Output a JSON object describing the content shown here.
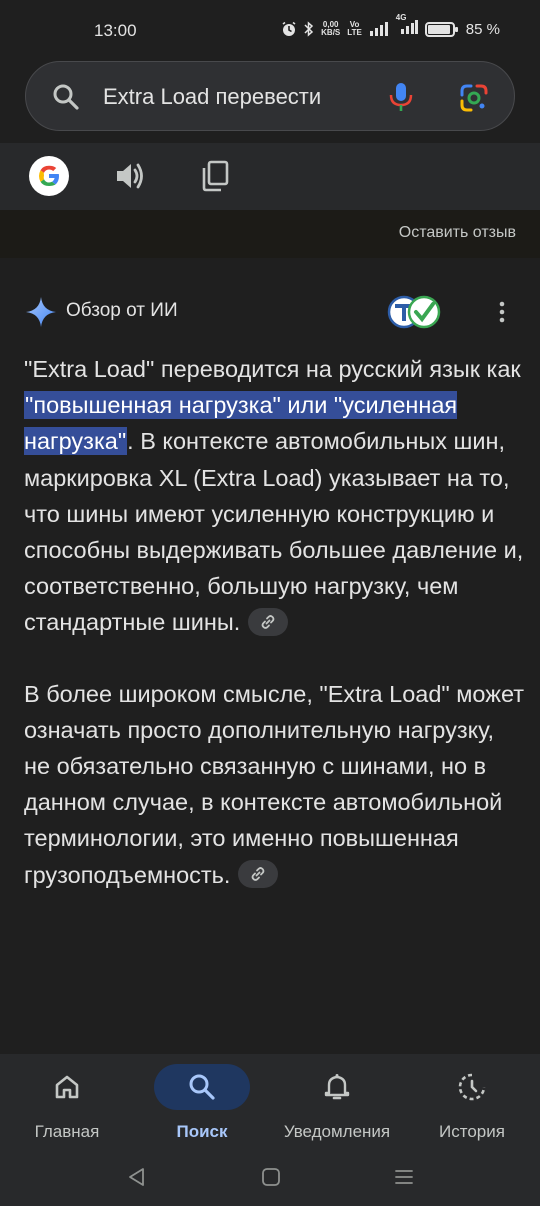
{
  "status": {
    "time": "13:00",
    "net_speed_top": "0,00",
    "net_speed_bottom": "KB/S",
    "volte_top": "Vo",
    "volte_bottom": "LTE",
    "lte_label": "4G",
    "battery": "85 %"
  },
  "search": {
    "query": "Extra Load перевести"
  },
  "tools": {
    "icons": [
      "google-logo",
      "speaker-icon",
      "copy-icon"
    ]
  },
  "feedback": {
    "label": "Оставить отзыв"
  },
  "ai_overview": {
    "title": "Обзор от ИИ",
    "p1_before": "\"Extra Load\" переводится на русский язык как ",
    "p1_highlight": "\"повышенная нагрузка\" или \"усиленная нагрузка\"",
    "p1_after": ". В контексте автомобильных шин, маркировка XL (Extra Load) указывает на то, что шины имеют усиленную конструкцию и способны выдерживать большее давление и, соответственно, большую нагрузку, чем стандартные шины.",
    "p2": "В более широком смысле, \"Extra Load\" может означать просто дополнительную нагрузку, не обязательно связанную с шинами, но в данном случае, в контексте автомобильной терминологии, это именно повышенная грузоподъемность."
  },
  "bottom_nav": {
    "items": [
      {
        "label": "Главная",
        "icon": "home-icon",
        "active": false
      },
      {
        "label": "Поиск",
        "icon": "search-icon",
        "active": true
      },
      {
        "label": "Уведомления",
        "icon": "bell-icon",
        "active": false
      },
      {
        "label": "История",
        "icon": "history-icon",
        "active": false
      }
    ]
  },
  "colors": {
    "background": "#1f1f1f",
    "highlight": "#354e99",
    "active_nav": "#a8c7fa"
  }
}
